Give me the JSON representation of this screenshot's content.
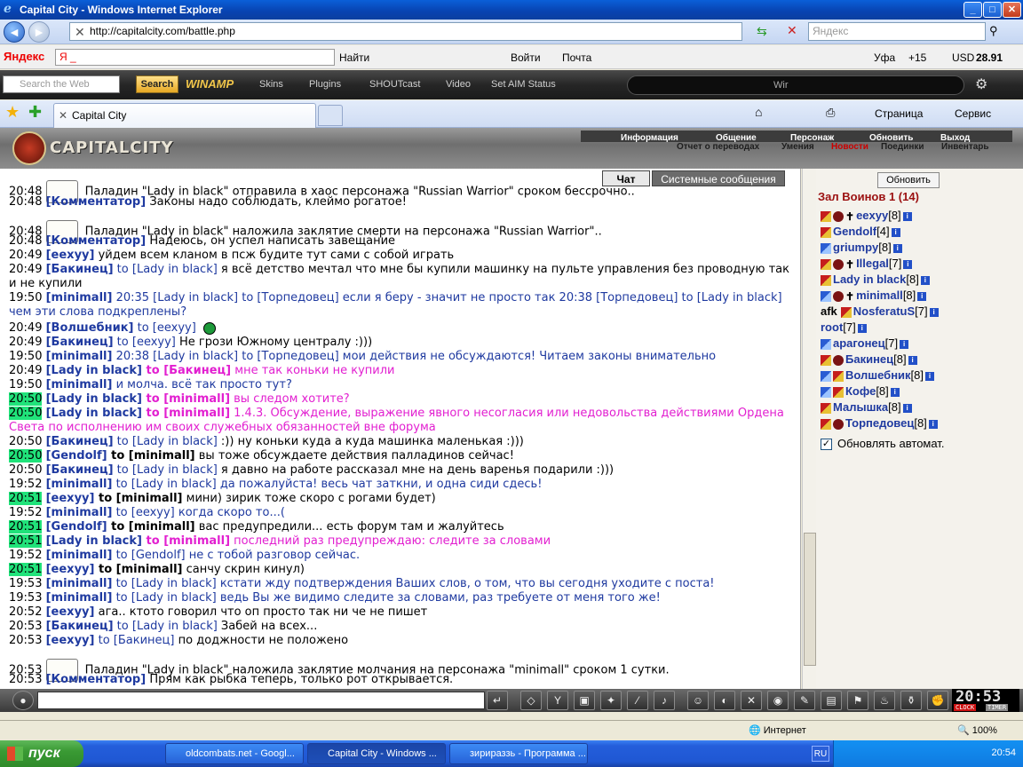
{
  "window": {
    "title": "Capital City - Windows Internet Explorer",
    "url": "http://capitalcity.com/battle.php",
    "search_placeholder": "Яндекс"
  },
  "yandex_bar": {
    "logo": "Яндекс",
    "input_value": "Я _",
    "find": "Найти",
    "login": "Войти",
    "mail": "Почта",
    "weather": "Уфа",
    "temp": "+15",
    "currency": "USD",
    "rate": "28.91"
  },
  "winamp_bar": {
    "search_placeholder": "Search the Web",
    "search_button": "Search",
    "logo": "WINAMP",
    "links": [
      "Skins",
      "Plugins",
      "SHOUTcast",
      "Video",
      "Set AIM Status"
    ],
    "player_label": "Wir"
  },
  "tabs": {
    "active_tab": "Capital City",
    "page_menu": "Страница",
    "service_menu": "Сервис"
  },
  "game": {
    "logo": "CAPITALCITY",
    "menu_top": [
      "Информация",
      "Общение",
      "Персонаж",
      "Обновить",
      "Выход"
    ],
    "menu_bottom": [
      "Отчет о переводах",
      "Умения",
      "Новости",
      "Поединки",
      "Инвентарь"
    ],
    "chat_tabs": [
      "Чат",
      "Системные сообщения"
    ]
  },
  "chat": [
    {
      "time": "20:48",
      "sys": true,
      "text": "Паладин \"Lady in black\" отправила в хаос персонажа \"Russian Warrior\" сроком бессрочно.."
    },
    {
      "time": "20:48",
      "from": "Комментатор",
      "text": "Законы надо соблюдать, клеймо рогатое!"
    },
    {
      "time": "20:48",
      "sys": true,
      "text": "Паладин \"Lady in black\" наложила заклятие смерти на персонажа \"Russian Warrior\".."
    },
    {
      "time": "20:48",
      "from": "Комментатор",
      "text": "Надеюсь, он успел написать завещание"
    },
    {
      "time": "20:49",
      "from": "eexyy",
      "text": "уйдем всем кланом в псж будите тут сами с собой играть"
    },
    {
      "time": "20:49",
      "from": "Бакинец",
      "to": "Lady in black",
      "text": "я всё детство мечтал что мне бы купили машинку на пульте управления без проводную так и не купили"
    },
    {
      "time": "19:50",
      "from": "minimall",
      "text": "20:35 [Lady in black] to [Торпедовец] если я беру - значит не просто так 20:38 [Торпедовец] to [Lady in black] чем эти слова подкреплены?"
    },
    {
      "time": "20:49",
      "from": "Волшебник",
      "to": "eexyy",
      "text": ""
    },
    {
      "time": "20:49",
      "from": "Бакинец",
      "to": "eexyy",
      "text": "Не грози Южному централу :)))"
    },
    {
      "time": "19:50",
      "from": "minimall",
      "text": "20:38 [Lady in black] to [Торпедовец] мои действия не обсуждаются! Читаем законы внимательно"
    },
    {
      "time": "20:49",
      "from": "Lady in black",
      "to": "Бакинец",
      "text": "мне так коньки не купили"
    },
    {
      "time": "19:50",
      "from": "minimall",
      "text": "и молча. всё так просто тут?"
    },
    {
      "time": "20:50",
      "from": "Lady in black",
      "to": "minimall",
      "text": "вы следом хотите?"
    },
    {
      "time": "20:50",
      "from": "Lady in black",
      "to": "minimall",
      "text": "1.4.3. Обсуждение, выражение явного несогласия или недовольства действиями Ордена Света по исполнению им своих служебных обязанностей вне форума"
    },
    {
      "time": "20:50",
      "from": "Бакинец",
      "to": "Lady in black",
      "text": ":)) ну коньки куда а куда машинка маленькая :)))"
    },
    {
      "time": "20:50",
      "from": "Gendolf",
      "to": "minimall",
      "text": "вы тоже обсуждаете действия палладинов сейчас!"
    },
    {
      "time": "20:50",
      "from": "Бакинец",
      "to": "Lady in black",
      "text": "я давно на работе рассказал мне на день варенья подарили :)))"
    },
    {
      "time": "19:52",
      "from": "minimall",
      "to": "Lady in black",
      "text": "да пожалуйста! весь чат заткни, и одна сиди сдесь!"
    },
    {
      "time": "20:51",
      "from": "eexyy",
      "to": "minimall",
      "text": "мини) зирик тоже скоро с рогами будет)"
    },
    {
      "time": "19:52",
      "from": "minimall",
      "to": "eexyy",
      "text": "когда скоро то...("
    },
    {
      "time": "20:51",
      "from": "Gendolf",
      "to": "minimall",
      "text": "вас предупредили... есть форум там и жалуйтесь"
    },
    {
      "time": "20:51",
      "from": "Lady in black",
      "to": "minimall",
      "text": "последний раз предупреждаю: следите за словами"
    },
    {
      "time": "19:52",
      "from": "minimall",
      "to": "Gendolf",
      "text": "не с тобой разговор сейчас."
    },
    {
      "time": "20:51",
      "from": "eexyy",
      "to": "minimall",
      "text": "санчу скрин кинул)"
    },
    {
      "time": "19:53",
      "from": "minimall",
      "to": "Lady in black",
      "text": "кстати жду подтверждения Ваших слов, о том, что вы сегодня уходите с поста!"
    },
    {
      "time": "19:53",
      "from": "minimall",
      "to": "Lady in black",
      "text": "ведь Вы же видимо следите за словами, раз требуете от меня того же!"
    },
    {
      "time": "20:52",
      "from": "eexyy",
      "text": "ага.. ктото говорил что оп просто так ни че не пишет"
    },
    {
      "time": "20:53",
      "from": "Бакинец",
      "to": "Lady in black",
      "text": "Забей на всех..."
    },
    {
      "time": "20:53",
      "from": "eexyy",
      "to": "Бакинец",
      "text": "по доджности не положено"
    },
    {
      "time": "20:53",
      "sys": true,
      "text": "Паладин \"Lady in black\" наложила заклятие молчания на персонажа \"minimall\" сроком 1 сутки."
    },
    {
      "time": "20:53",
      "from": "Комментатор",
      "text": "Прям как рыбка теперь, только рот открывается."
    }
  ],
  "right_panel": {
    "refresh": "Обновить",
    "room_title": "Зал Воинов 1 (14)",
    "users": [
      {
        "name": "eexyy",
        "level": "[8]"
      },
      {
        "name": "Gendolf",
        "level": "[4]"
      },
      {
        "name": "griumpy",
        "level": "[8]"
      },
      {
        "name": "Illegal",
        "level": "[7]"
      },
      {
        "name": "Lady in black",
        "level": "[8]"
      },
      {
        "name": "minimall",
        "level": "[8]"
      },
      {
        "name": "NosferatuS",
        "level": "[7]",
        "status": "afk"
      },
      {
        "name": "root",
        "level": "[7]"
      },
      {
        "name": "арагонец",
        "level": "[7]"
      },
      {
        "name": "Бакинец",
        "level": "[8]"
      },
      {
        "name": "Волшебник",
        "level": "[8]"
      },
      {
        "name": "Кофе",
        "level": "[8]"
      },
      {
        "name": "Малышка",
        "level": "[8]"
      },
      {
        "name": "Торпедовец",
        "level": "[8]"
      }
    ],
    "auto_refresh": "Обновлять автомат."
  },
  "clock": {
    "time": "20:53",
    "clock_label": "CLOCK",
    "timer_label": "TIMER"
  },
  "statusbar": {
    "zone": "Интернет",
    "zoom": "100%"
  },
  "taskbar": {
    "start": "пуск",
    "tasks": [
      "oldcombats.net - Googl...",
      "Capital City - Windows ...",
      "зирираззь - Программа ..."
    ],
    "lang": "RU",
    "clock": "20:54"
  }
}
